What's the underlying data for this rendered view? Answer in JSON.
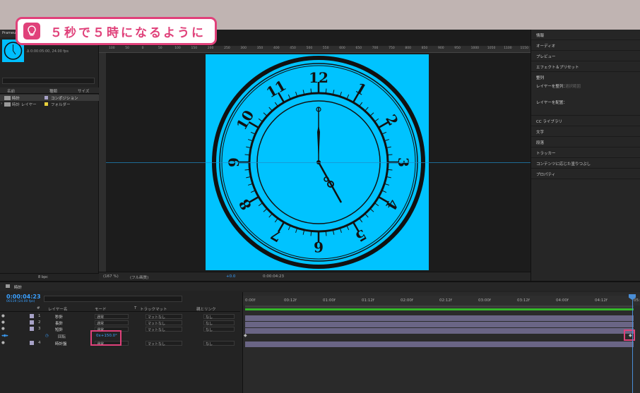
{
  "banner": {
    "text": "５秒で５時になるように"
  },
  "project": {
    "tab": "Prameur",
    "comp_info": "Δ 0:00:05:00, 24.00 fps",
    "headers": {
      "name": "名前",
      "type": "種類",
      "size": "サイズ"
    },
    "items": [
      {
        "name": "時計",
        "type": "コンポジション"
      },
      {
        "name": "時計 レイヤー",
        "type": "フォルダー"
      }
    ],
    "bpc": "8 bpc"
  },
  "viewer": {
    "ruler": [
      "100",
      "50",
      "0",
      "50",
      "100",
      "150",
      "200",
      "250",
      "300",
      "350",
      "400",
      "450",
      "500",
      "550",
      "600",
      "650",
      "700",
      "750",
      "800",
      "850",
      "900",
      "950",
      "1000",
      "1050",
      "1100",
      "1150"
    ],
    "zoom": "(167 %)",
    "resolution": "(フル画質)",
    "exposure": "+0.0",
    "time": "0:00:04:23",
    "clock_numerals": [
      "12",
      "1",
      "2",
      "3",
      "4",
      "5",
      "6",
      "7",
      "8",
      "9",
      "10",
      "11"
    ],
    "colors": {
      "comp_bg": "#00c3ff",
      "clock": "#111111"
    }
  },
  "right_panel": {
    "items": [
      "情報",
      "オーディオ",
      "プレビュー",
      "エフェクト＆プリセット"
    ],
    "align": {
      "title": "整列",
      "align_layers_label": "レイヤーを整列：",
      "align_target": "選択範囲",
      "distribute_label": "レイヤーを配置："
    },
    "items2": [
      "CC ライブラリ",
      "文字",
      "段落",
      "トラッカー",
      "コンテンツに応じた塗りつぶし",
      "プロパティ"
    ]
  },
  "timeline": {
    "tab": "時計",
    "timecode": "0:00:04:23",
    "frames": "00119 (24.00 fps)",
    "headers": {
      "num": "#",
      "name": "レイヤー名",
      "mode": "モード",
      "t": "T",
      "trackmatte": "トラックマット",
      "parent": "親とリンク"
    },
    "layers": [
      {
        "num": "1",
        "name": "秒針",
        "mode": "通常",
        "matte": "マットなし",
        "parent": "なし"
      },
      {
        "num": "2",
        "name": "長針",
        "mode": "通常",
        "matte": "マットなし",
        "parent": "なし"
      },
      {
        "num": "3",
        "name": "短針",
        "mode": "通常",
        "matte": "マットなし",
        "parent": "なし"
      }
    ],
    "rotation": {
      "label": "回転",
      "value": "0x+150.0°"
    },
    "layer4": {
      "num": "4",
      "name": "時計盤",
      "mode": "通常",
      "matte": "マットなし",
      "parent": "なし"
    },
    "ticks": [
      "0:00f",
      "00:12f",
      "01:00f",
      "01:12f",
      "02:00f",
      "02:12f",
      "03:00f",
      "03:12f",
      "04:00f",
      "04:12f",
      "05:0"
    ],
    "colors": {
      "highlight": "#e0417a",
      "timecode": "#3aa0ff",
      "workarea": "#35b82a"
    }
  }
}
